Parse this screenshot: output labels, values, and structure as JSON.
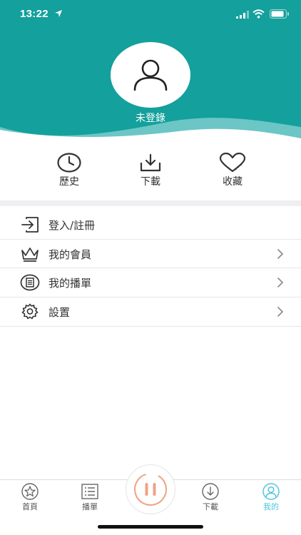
{
  "status_bar": {
    "time": "13:22"
  },
  "profile": {
    "login_status": "未登錄"
  },
  "shortcuts": [
    {
      "label": "歷史",
      "icon": "clock-icon"
    },
    {
      "label": "下載",
      "icon": "download-icon"
    },
    {
      "label": "收藏",
      "icon": "heart-icon"
    }
  ],
  "menu": [
    {
      "label": "登入/註冊",
      "icon": "login-icon"
    },
    {
      "label": "我的會員",
      "icon": "crown-icon"
    },
    {
      "label": "我的播單",
      "icon": "playlist-icon"
    },
    {
      "label": "設置",
      "icon": "gear-icon"
    }
  ],
  "tabbar": {
    "tabs": [
      {
        "label": "首頁",
        "icon": "star-icon"
      },
      {
        "label": "播單",
        "icon": "list-icon"
      },
      {
        "label": "下載",
        "icon": "download-icon"
      },
      {
        "label": "我的",
        "icon": "user-icon",
        "active": true
      }
    ],
    "player_button": "pause-icon"
  },
  "colors": {
    "brand": "#14a09c",
    "active_tab": "#4fc6dc",
    "player_accent": "#f0a285"
  }
}
